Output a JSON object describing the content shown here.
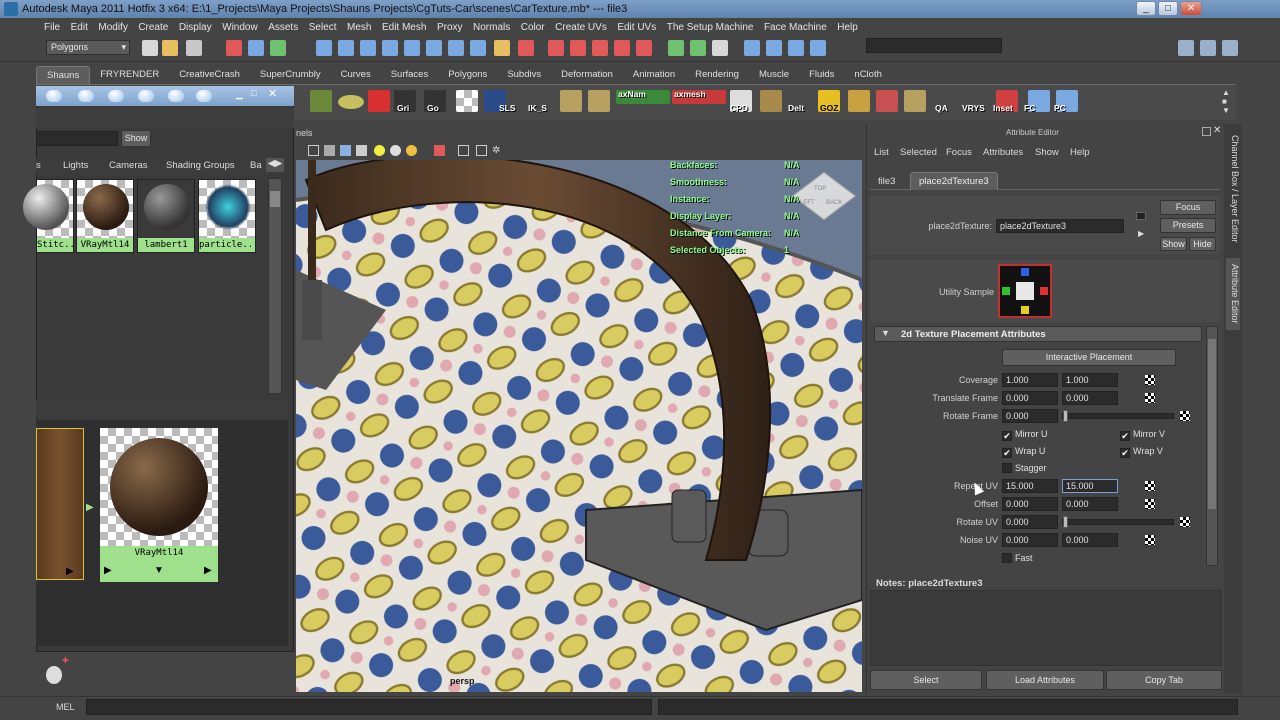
{
  "window": {
    "title": "Autodesk Maya 2011 Hotfix 3 x64: E:\\1_Projects\\Maya Projects\\Shauns Projects\\CgTuts-Car\\scenes\\CarTexture.mb*  ---  file3",
    "minimize": "_",
    "maximize": "□",
    "close": "✕"
  },
  "menus": [
    "File",
    "Edit",
    "Modify",
    "Create",
    "Display",
    "Window",
    "Assets",
    "Select",
    "Mesh",
    "Edit Mesh",
    "Proxy",
    "Normals",
    "Color",
    "Create UVs",
    "Edit UVs",
    "The Setup Machine",
    "Face Machine",
    "Help"
  ],
  "status_line": {
    "mode": "Polygons"
  },
  "shelf": {
    "tabs": [
      "Shauns",
      "FRYRENDER",
      "CreativeCrash",
      "SuperCrumbly",
      "Curves",
      "Surfaces",
      "Polygons",
      "Subdivs",
      "Deformation",
      "Animation",
      "Rendering",
      "Muscle",
      "Fluids",
      "nCloth"
    ],
    "active_tab": "Shauns",
    "icon_labels": [
      "Gri",
      "Go",
      "SLS",
      "IK_S",
      "axNam",
      "axmesh",
      "CPD",
      "Delt",
      "GOZ",
      "QA",
      "VRYS",
      "Inset",
      "FC",
      "PC"
    ]
  },
  "hypershade": {
    "show_button": "Show",
    "tabs": [
      "s",
      "Lights",
      "Cameras",
      "Shading Groups",
      "Ba"
    ],
    "swatches": [
      "Stitc...",
      "VRayMtl14",
      "lambert1",
      "particle..."
    ],
    "work_node": "VRayMtl14",
    "arrows": [
      "▶",
      "▼",
      "▶"
    ]
  },
  "viewport": {
    "panel_label": "nels",
    "hud": [
      {
        "label": "Backfaces:",
        "value": "N/A"
      },
      {
        "label": "Smoothness:",
        "value": "N/A"
      },
      {
        "label": "Instance:",
        "value": "N/A"
      },
      {
        "label": "Display Layer:",
        "value": "N/A"
      },
      {
        "label": "Distance From Camera:",
        "value": "N/A"
      },
      {
        "label": "Selected Objects:",
        "value": "1"
      }
    ],
    "camera": "persp",
    "viewcube": {
      "top": "TOP",
      "left": "LEFT",
      "back": "BACK"
    }
  },
  "attribute_editor": {
    "title": "Attribute Editor",
    "menu": [
      "List",
      "Selected",
      "Focus",
      "Attributes",
      "Show",
      "Help"
    ],
    "tabs": [
      "file3",
      "place2dTexture3"
    ],
    "active_tab": "place2dTexture3",
    "node_label": "place2dTexture:",
    "node_value": "place2dTexture3",
    "focus_button": "Focus",
    "presets_button": "Presets",
    "show_button": "Show",
    "hide_button": "Hide",
    "utility_sample_label": "Utility Sample",
    "section_title": "2d Texture Placement Attributes",
    "interactive_placement": "Interactive Placement",
    "rows": [
      {
        "label": "Coverage",
        "v1": "1.000",
        "v2": "1.000"
      },
      {
        "label": "Translate Frame",
        "v1": "0.000",
        "v2": "0.000"
      },
      {
        "label": "Rotate Frame",
        "v1": "0.000"
      },
      {
        "label": "Repeat UV",
        "v1": "15.000",
        "v2": "15.000"
      },
      {
        "label": "Offset",
        "v1": "0.000",
        "v2": "0.000"
      },
      {
        "label": "Rotate UV",
        "v1": "0.000"
      },
      {
        "label": "Noise UV",
        "v1": "0.000",
        "v2": "0.000"
      }
    ],
    "checks": {
      "mirror_u": "Mirror U",
      "mirror_v": "Mirror V",
      "wrap_u": "Wrap U",
      "wrap_v": "Wrap V",
      "stagger": "Stagger",
      "fast": "Fast",
      "check_mark": "✔"
    },
    "notes_label": "Notes:  place2dTexture3",
    "bottom_buttons": [
      "Select",
      "Load Attributes",
      "Copy Tab"
    ]
  },
  "side_tabs": [
    "Channel Box / Layer Editor",
    "Attribute Editor"
  ],
  "command_line": {
    "label": "MEL"
  },
  "colors": {
    "ui_bg": "#444444",
    "hud_green": "#8dff8d",
    "swatch_green": "#9ee08c",
    "title_blue": "#7ea0c8"
  }
}
